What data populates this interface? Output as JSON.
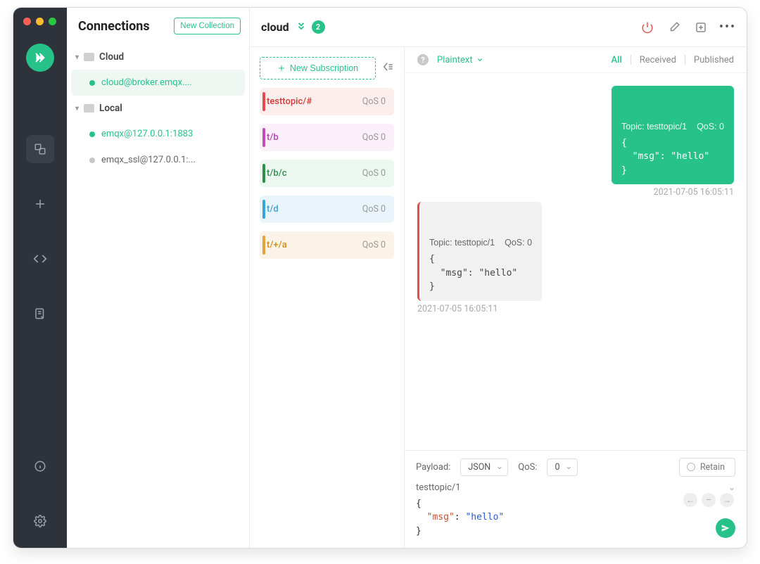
{
  "sidebar": {
    "title": "Connections",
    "new_collection_btn": "New Collection",
    "groups": [
      {
        "name": "Cloud",
        "items": [
          {
            "label": "cloud@broker.emqx....",
            "status": "online",
            "selected": true
          }
        ]
      },
      {
        "name": "Local",
        "items": [
          {
            "label": "emqx@127.0.0.1:1883",
            "status": "online",
            "selected": false
          },
          {
            "label": "emqx_ssl@127.0.0.1:...",
            "status": "offline",
            "selected": false
          }
        ]
      }
    ]
  },
  "header": {
    "connection_name": "cloud",
    "badge_count": "2"
  },
  "subscriptions": {
    "new_sub_btn": "New Subscription",
    "items": [
      {
        "topic": "testtopic/#",
        "qos": "QoS 0",
        "color": "red"
      },
      {
        "topic": "t/b",
        "qos": "QoS 0",
        "color": "mag"
      },
      {
        "topic": "t/b/c",
        "qos": "QoS 0",
        "color": "grn"
      },
      {
        "topic": "t/d",
        "qos": "QoS 0",
        "color": "blu"
      },
      {
        "topic": "t/+/a",
        "qos": "QoS 0",
        "color": "org"
      }
    ]
  },
  "filters": {
    "payload_format": "Plaintext",
    "all": "All",
    "received": "Received",
    "published": "Published"
  },
  "messages": [
    {
      "direction": "sent",
      "topic_label": "Topic: testtopic/1",
      "qos_label": "QoS: 0",
      "body": "{\n  \"msg\": \"hello\"\n}",
      "timestamp": "2021-07-05 16:05:11"
    },
    {
      "direction": "received",
      "topic_label": "Topic: testtopic/1",
      "qos_label": "QoS: 0",
      "body": "{\n  \"msg\": \"hello\"\n}",
      "timestamp": "2021-07-05 16:05:11"
    }
  ],
  "publish": {
    "payload_label": "Payload:",
    "payload_format": "JSON",
    "qos_label": "QoS:",
    "qos_value": "0",
    "retain_label": "Retain",
    "topic": "testtopic/1",
    "body_key": "\"msg\"",
    "body_val": "\"hello\""
  }
}
